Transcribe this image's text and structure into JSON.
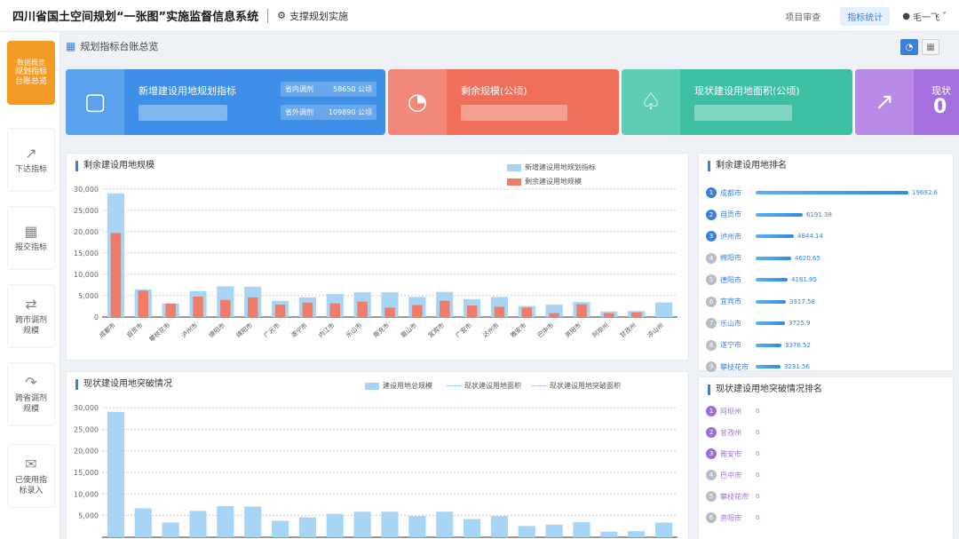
{
  "header": {
    "title": "四川省国土空间规划“一张图”实施监督信息系统",
    "system_link": "支撑规划实施",
    "tabs": [
      {
        "label": "项目审查",
        "active": false
      },
      {
        "label": "指标统计",
        "active": true
      }
    ],
    "user": "毛一飞"
  },
  "sidebar": {
    "items": [
      {
        "label_top": "数据概览",
        "label": "规划指标台账总览",
        "icon": "dashboard-icon",
        "active": true
      },
      {
        "label": "下达指标",
        "icon": "trend-chart-icon",
        "active": false
      },
      {
        "label": "报交指标",
        "icon": "grid-icon",
        "active": false
      },
      {
        "label": "跨市调剂规模",
        "icon": "exchange-icon",
        "active": false
      },
      {
        "label": "跨省调剂规模",
        "icon": "transfer-icon",
        "active": false
      },
      {
        "label": "已使用指标录入",
        "icon": "inbox-icon",
        "active": false
      }
    ]
  },
  "breadcrumb": "规划指标台账总览",
  "kpis": [
    {
      "title": "新增建设用地规划指标",
      "color": "#3d8fe8",
      "icon": "map-fold-icon",
      "sub": [
        {
          "label": "省内调剂",
          "value": "58650 公顷"
        },
        {
          "label": "省外调剂",
          "value": "109890 公顷"
        }
      ]
    },
    {
      "title": "剩余规模(公顷)",
      "color": "#ef6f5b",
      "icon": "pie-icon",
      "sub": []
    },
    {
      "title": "现状建设用地面积(公顷)",
      "color": "#3dbfa4",
      "icon": "crane-icon",
      "sub": []
    },
    {
      "title": "现状",
      "color": "#a66fe0",
      "icon": "area-trend-icon",
      "big": "0",
      "sub": []
    }
  ],
  "chart1": {
    "title": "剩余建设用地规模",
    "legend": [
      {
        "name": "新增建设用地规划指标",
        "color": "#a8d4f5"
      },
      {
        "name": "剩余建设用地规模",
        "color": "#ef7c68"
      }
    ]
  },
  "chart2": {
    "title": "现状建设用地突破情况",
    "legend": [
      {
        "name": "建设用地总规模",
        "color": "#a8d4f5"
      },
      {
        "name": "现状建设用地面积",
        "color": "#6fc0e8"
      },
      {
        "name": "现状建设用地突破面积",
        "color": "#c7a0e8"
      }
    ]
  },
  "chart_data": [
    {
      "type": "bar",
      "title": "剩余建设用地规模",
      "categories": [
        "成都市",
        "自贡市",
        "攀枝花市",
        "泸州市",
        "德阳市",
        "绵阳市",
        "广元市",
        "遂宁市",
        "内江市",
        "乐山市",
        "南充市",
        "眉山市",
        "宜宾市",
        "广安市",
        "达州市",
        "雅安市",
        "巴中市",
        "资阳市",
        "阿坝州",
        "甘孜州",
        "凉山州"
      ],
      "series": [
        {
          "name": "新增建设用地规划指标",
          "values": [
            29000,
            6500,
            3200,
            6100,
            7200,
            7100,
            3800,
            4600,
            5400,
            5800,
            5800,
            4700,
            5900,
            4200,
            4700,
            2600,
            2900,
            3500,
            1300,
            1400,
            3400
          ]
        },
        {
          "name": "剩余建设用地规模",
          "values": [
            19700,
            6200,
            3100,
            4800,
            4000,
            4600,
            2900,
            3400,
            3200,
            3600,
            2200,
            2800,
            3800,
            2700,
            2400,
            2200,
            900,
            3000,
            900,
            1100,
            0
          ]
        }
      ],
      "ylim": [
        0,
        30000
      ],
      "yticks": [
        "0",
        "5,000",
        "10,000",
        "15,000",
        "20,000",
        "25,000",
        "30,000"
      ]
    },
    {
      "type": "bar",
      "title": "现状建设用地突破情况",
      "categories": [
        "成都市",
        "自贡市",
        "攀枝花市",
        "泸州市",
        "德阳市",
        "绵阳市",
        "广元市",
        "遂宁市",
        "内江市",
        "乐山市",
        "南充市",
        "眉山市",
        "宜宾市",
        "广安市",
        "达州市",
        "雅安市",
        "巴中市",
        "资阳市",
        "阿坝州",
        "甘孜州",
        "凉山州"
      ],
      "series": [
        {
          "name": "建设用地总规模",
          "values": [
            29000,
            6700,
            3400,
            6100,
            7200,
            7100,
            3800,
            4600,
            5400,
            5900,
            5900,
            4900,
            5900,
            4200,
            4900,
            2600,
            2900,
            3500,
            1300,
            1400,
            3400
          ]
        }
      ],
      "ylim": [
        0,
        30000
      ],
      "yticks": [
        "5,000",
        "10,000",
        "15,000",
        "20,000",
        "25,000",
        "30,000"
      ]
    }
  ],
  "ranking1": {
    "title": "剩余建设用地排名",
    "items": [
      {
        "rank": "1",
        "city": "成都市",
        "value": "19692.6",
        "pct": 1.0
      },
      {
        "rank": "2",
        "city": "自贡市",
        "value": "6191.38",
        "pct": 0.31
      },
      {
        "rank": "3",
        "city": "泸州市",
        "value": "4844.14",
        "pct": 0.25
      },
      {
        "rank": "4",
        "city": "绵阳市",
        "value": "4620.65",
        "pct": 0.23
      },
      {
        "rank": "5",
        "city": "德阳市",
        "value": "4181.95",
        "pct": 0.21
      },
      {
        "rank": "6",
        "city": "宜宾市",
        "value": "3917.58",
        "pct": 0.2
      },
      {
        "rank": "7",
        "city": "乐山市",
        "value": "3725.9",
        "pct": 0.19
      },
      {
        "rank": "8",
        "city": "遂宁市",
        "value": "3376.52",
        "pct": 0.17
      },
      {
        "rank": "9",
        "city": "攀枝花市",
        "value": "3231.56",
        "pct": 0.16
      }
    ]
  },
  "ranking2": {
    "title": "现状建设用地突破情况排名",
    "items": [
      {
        "rank": "1",
        "city": "阿坝州",
        "value": "0"
      },
      {
        "rank": "2",
        "city": "甘孜州",
        "value": "0"
      },
      {
        "rank": "3",
        "city": "雅安市",
        "value": "0"
      },
      {
        "rank": "4",
        "city": "巴中市",
        "value": "0"
      },
      {
        "rank": "5",
        "city": "攀枝花市",
        "value": "0"
      },
      {
        "rank": "6",
        "city": "资阳市",
        "value": "0"
      }
    ]
  }
}
